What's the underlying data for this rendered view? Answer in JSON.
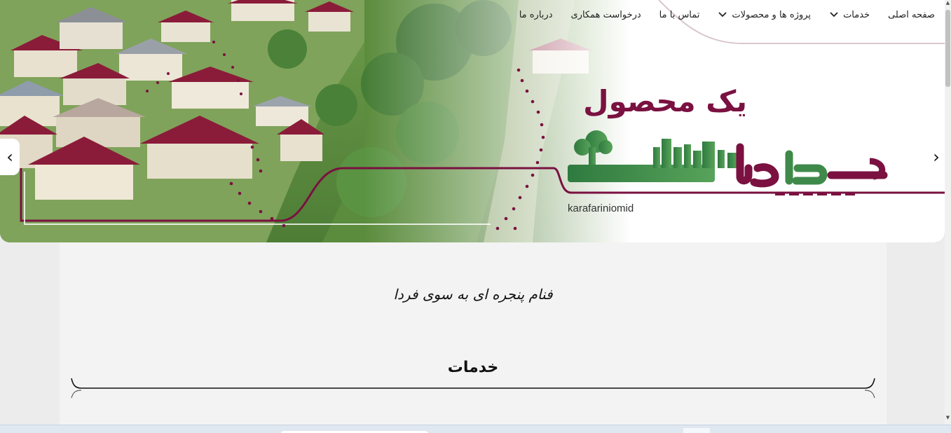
{
  "nav": {
    "items": [
      {
        "label": "صفحه اصلی",
        "dropdown": false
      },
      {
        "label": "خدمات",
        "dropdown": true
      },
      {
        "label": "پروژه ها و محصولات",
        "dropdown": true
      },
      {
        "label": "تماس با ما",
        "dropdown": false
      },
      {
        "label": "درخواست همکاری",
        "dropdown": false
      },
      {
        "label": "درباره ما",
        "dropdown": false
      }
    ]
  },
  "hero": {
    "slogan_top": "یک محصول",
    "brand_name": "هـر روستا",
    "brand_url": "karafariniomid",
    "prev_arrow": "‹",
    "next_arrow": "›"
  },
  "content": {
    "tagline": "فنام پنجره ای به سوی فردا",
    "section_title": "خدمات"
  },
  "colors": {
    "brand_maroon": "#7a1140",
    "brand_green": "#3f8a4a",
    "page_bg": "#ececec",
    "content_bg": "#f3f3f3"
  },
  "icons": {
    "nav_dropdown": "chevron-down-icon",
    "slider_prev": "chevron-left-icon",
    "slider_next": "chevron-right-icon"
  }
}
